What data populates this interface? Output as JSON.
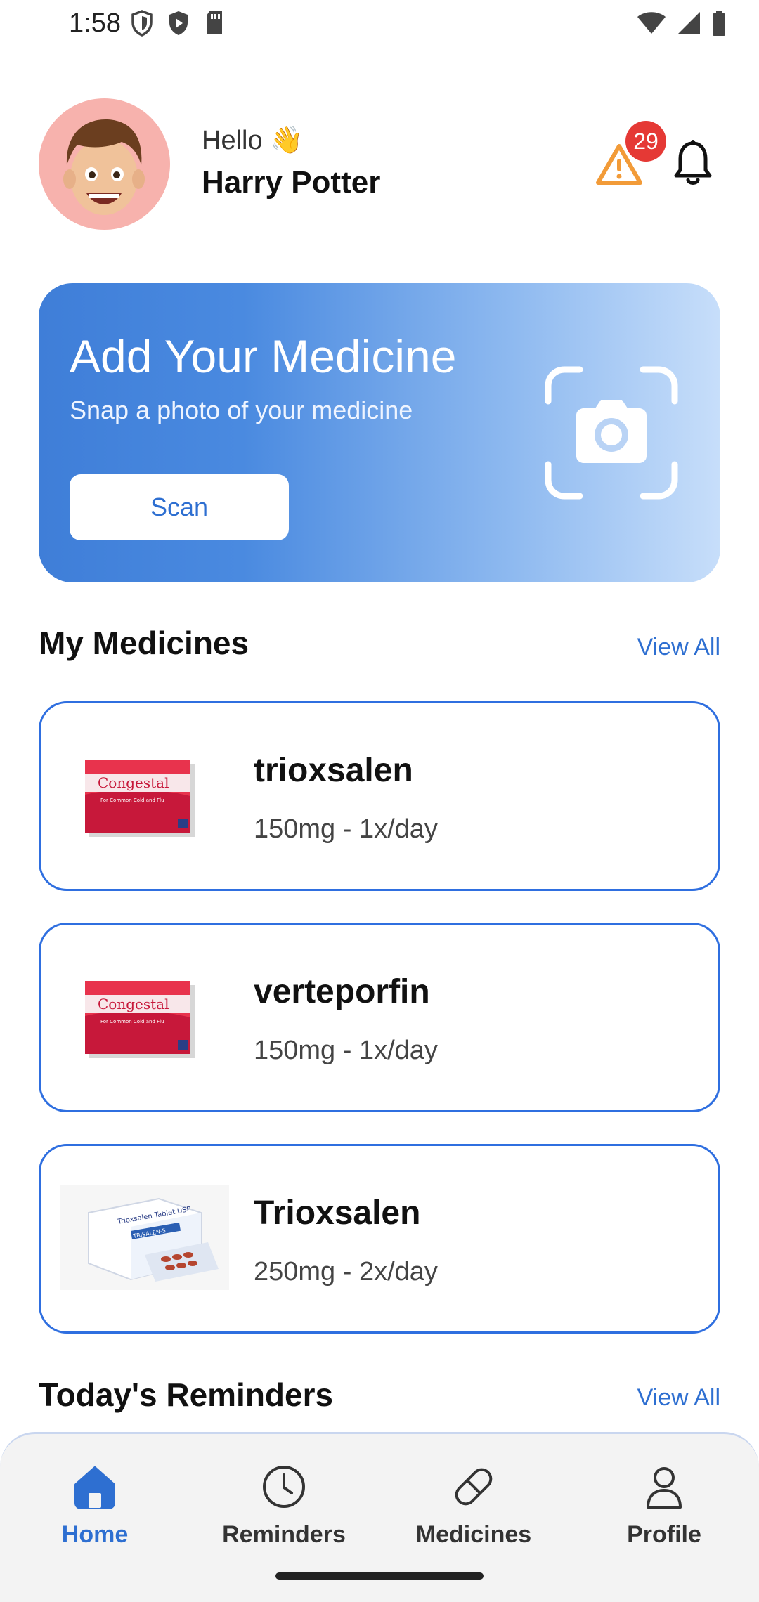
{
  "status_bar": {
    "time": "1:58"
  },
  "header": {
    "greeting": "Hello 👋",
    "user_name": "Harry Potter",
    "alert_count": "29"
  },
  "banner": {
    "title": "Add Your Medicine",
    "subtitle": "Snap a photo of your medicine",
    "scan_label": "Scan"
  },
  "my_medicines": {
    "title": "My Medicines",
    "view_all": "View All",
    "items": [
      {
        "name": "trioxsalen",
        "dosage": "150mg - 1x/day",
        "box_brand": "Congestal",
        "box_sub": "For Common Cold and Flu"
      },
      {
        "name": "verteporfin",
        "dosage": "150mg - 1x/day",
        "box_brand": "Congestal",
        "box_sub": "For Common Cold and Flu"
      },
      {
        "name": "Trioxsalen",
        "dosage": "250mg - 2x/day",
        "box_brand": "Trioxsalen Tablet USP",
        "box_sub": "TRISALEN-5"
      }
    ]
  },
  "reminders": {
    "title": "Today's Reminders",
    "view_all": "View All"
  },
  "nav": {
    "home": "Home",
    "reminders": "Reminders",
    "medicines": "Medicines",
    "profile": "Profile"
  },
  "colors": {
    "accent": "#2e6fd1",
    "badge": "#e53935",
    "warning": "#f29b38",
    "card_border": "#2f6fe0"
  }
}
